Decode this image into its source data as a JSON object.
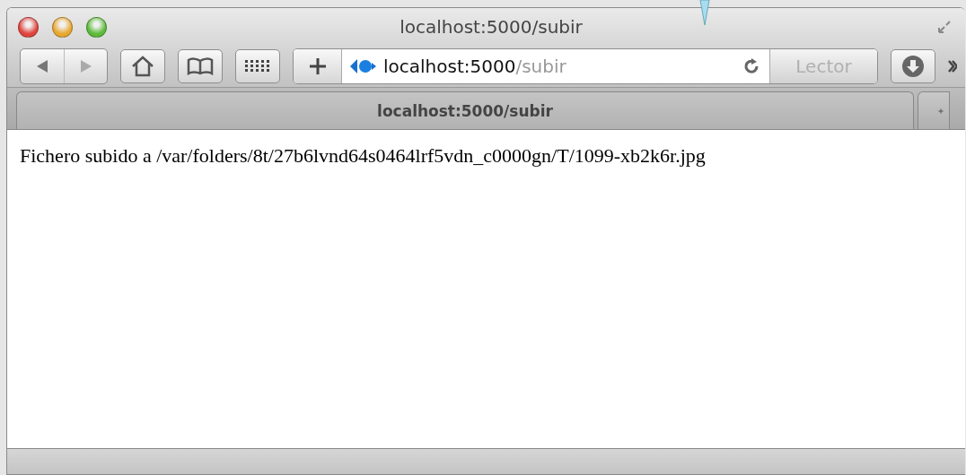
{
  "window": {
    "title": "localhost:5000/subir"
  },
  "address_bar": {
    "host": "localhost:5000",
    "path": "/subir"
  },
  "reader_button": {
    "label": "Lector",
    "disabled": true
  },
  "tabs": [
    {
      "label": "localhost:5000/subir",
      "selected": true
    }
  ],
  "content": {
    "text": "Fichero subido a /var/folders/8t/27b6lvnd64s0464lrf5vdn_c0000gn/T/1099-xb2k6r.jpg"
  }
}
